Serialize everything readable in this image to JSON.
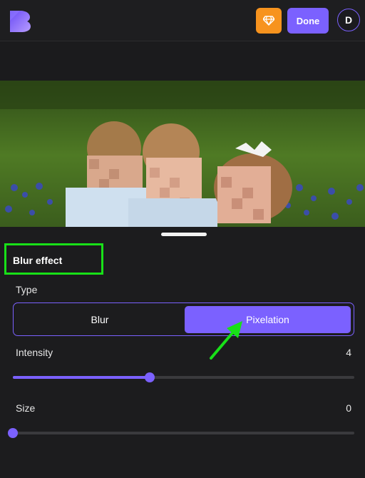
{
  "header": {
    "logo_icon": "b-logo-icon",
    "premium_icon": "diamond-icon",
    "done_label": "Done",
    "avatar_initial": "D",
    "accent_color": "#7b61ff",
    "premium_color": "#f7931e"
  },
  "panel": {
    "title": "Blur effect",
    "type_label": "Type",
    "type_options": [
      "Blur",
      "Pixelation"
    ],
    "selected_type": "Pixelation",
    "intensity": {
      "label": "Intensity",
      "value": "4",
      "fraction": 0.4
    },
    "size": {
      "label": "Size",
      "value": "0",
      "fraction": 0.0
    }
  },
  "annotation": {
    "highlight_color": "#18e018"
  }
}
